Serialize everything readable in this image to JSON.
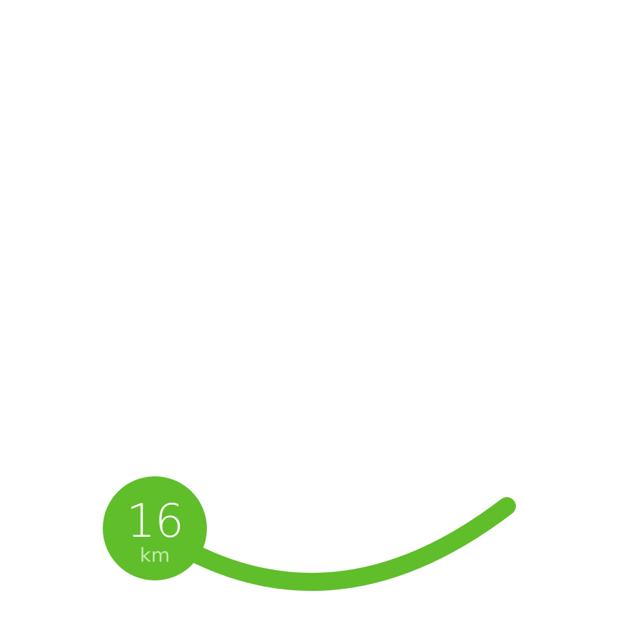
{
  "progress_gauge": {
    "value": "16",
    "unit": "km",
    "color": "#5fbe2a",
    "unit_color": "#c4e9ad"
  }
}
